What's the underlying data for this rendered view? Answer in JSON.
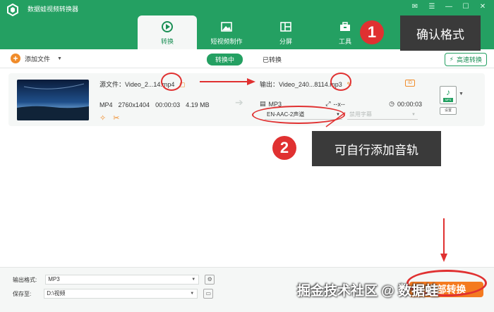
{
  "app": {
    "title": "数据蛙视频转换器"
  },
  "window": {
    "controls": [
      "feedback-icon",
      "menu-icon",
      "minimize-icon",
      "maximize-icon",
      "close-icon"
    ]
  },
  "tabs": [
    {
      "label": "转换",
      "icon": "convert-icon",
      "active": true
    },
    {
      "label": "短视频制作",
      "icon": "image-icon",
      "active": false
    },
    {
      "label": "分屏",
      "icon": "split-screen-icon",
      "active": false
    },
    {
      "label": "工具",
      "icon": "toolbox-icon",
      "active": false
    }
  ],
  "toolbar": {
    "add_file": "添加文件",
    "converting": "转换中",
    "converted": "已转换",
    "fast_convert": "高速转换"
  },
  "file": {
    "source_label": "源文件：Video_2...14",
    "source_ext": ".mp4",
    "format": "MP4",
    "resolution": "2760x1404",
    "duration": "00:00:03",
    "size": "4.19 MB",
    "output_label": "输出：Video_240...8114",
    "output_ext": ".mp3",
    "output_format": "MP3",
    "output_res": "--x--",
    "output_duration": "00:00:03",
    "audio_track": "EN-AAC-2声道",
    "subtitle": "禁用字幕",
    "format_setting": "设置",
    "format_box": "MP3"
  },
  "bottom": {
    "output_format_label": "输出格式:",
    "output_format_value": "MP3",
    "save_to_label": "保存至:",
    "save_to_value": "D:\\视频",
    "convert_all": "全部转换"
  },
  "annotations": {
    "step1_number": "1",
    "step1_text": "确认格式",
    "step2_number": "2",
    "step2_text": "可自行添加音轨",
    "watermark": "掘金技术社区 @ 数据蛙"
  },
  "colors": {
    "brand": "#24a062",
    "accent": "#f08c2a",
    "highlight": "#e03131"
  }
}
